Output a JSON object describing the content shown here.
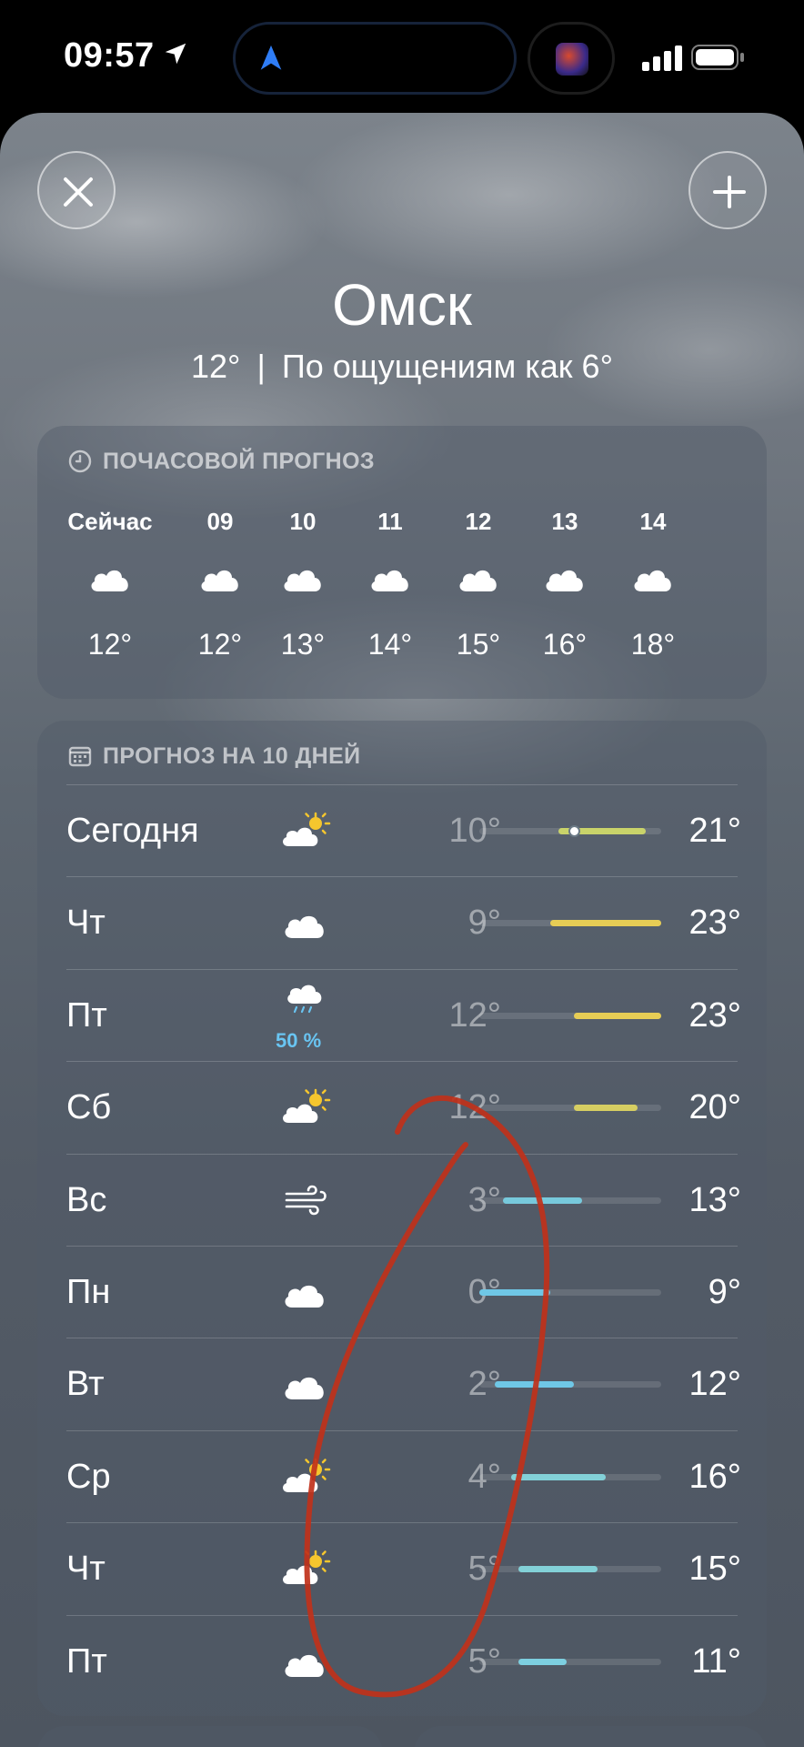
{
  "status_bar": {
    "time": "09:57"
  },
  "location": {
    "city": "Омск",
    "current_temp": "12°",
    "separator": "|",
    "feels_like": "По ощущениям как 6°"
  },
  "hourly": {
    "header": "ПОЧАСОВОЙ ПРОГНОЗ",
    "items": [
      {
        "time": "Сейчас",
        "icon": "cloud-icon",
        "temp": "12°"
      },
      {
        "time": "09",
        "icon": "cloud-icon",
        "temp": "12°"
      },
      {
        "time": "10",
        "icon": "cloud-icon",
        "temp": "13°"
      },
      {
        "time": "11",
        "icon": "cloud-icon",
        "temp": "14°"
      },
      {
        "time": "12",
        "icon": "cloud-icon",
        "temp": "15°"
      },
      {
        "time": "13",
        "icon": "cloud-icon",
        "temp": "16°"
      },
      {
        "time": "14",
        "icon": "cloud-icon",
        "temp": "18°"
      }
    ]
  },
  "daily": {
    "header": "ПРОГНОЗ НА 10 ДНЕЙ",
    "range": [
      0,
      23
    ],
    "days": [
      {
        "name": "Сегодня",
        "icon": "partly-sunny-icon",
        "pop": "",
        "lo": "10°",
        "hi": "21°",
        "lo_val": 10,
        "hi_val": 21,
        "current_val": 12,
        "color": "#c9d36a"
      },
      {
        "name": "Чт",
        "icon": "cloud-icon",
        "pop": "",
        "lo": "9°",
        "hi": "23°",
        "lo_val": 9,
        "hi_val": 23,
        "color": "#e7cd55"
      },
      {
        "name": "Пт",
        "icon": "rain-cloud-icon",
        "pop": "50 %",
        "lo": "12°",
        "hi": "23°",
        "lo_val": 12,
        "hi_val": 23,
        "color": "#e7cd55"
      },
      {
        "name": "Сб",
        "icon": "partly-sunny-icon",
        "pop": "",
        "lo": "12°",
        "hi": "20°",
        "lo_val": 12,
        "hi_val": 20,
        "color": "#d6ce62"
      },
      {
        "name": "Вс",
        "icon": "wind-icon",
        "pop": "",
        "lo": "3°",
        "hi": "13°",
        "lo_val": 3,
        "hi_val": 13,
        "color": "#77c9dc"
      },
      {
        "name": "Пн",
        "icon": "cloud-icon",
        "pop": "",
        "lo": "0°",
        "hi": "9°",
        "lo_val": 0,
        "hi_val": 9,
        "color": "#6fc7e6"
      },
      {
        "name": "Вт",
        "icon": "cloud-icon",
        "pop": "",
        "lo": "2°",
        "hi": "12°",
        "lo_val": 2,
        "hi_val": 12,
        "color": "#6fc7e6"
      },
      {
        "name": "Ср",
        "icon": "partly-sunny-icon",
        "pop": "",
        "lo": "4°",
        "hi": "16°",
        "lo_val": 4,
        "hi_val": 16,
        "color": "#83d1d8"
      },
      {
        "name": "Чт",
        "icon": "partly-sunny-icon",
        "pop": "",
        "lo": "5°",
        "hi": "15°",
        "lo_val": 5,
        "hi_val": 15,
        "color": "#83d1d8"
      },
      {
        "name": "Пт",
        "icon": "cloud-icon",
        "pop": "",
        "lo": "5°",
        "hi": "11°",
        "lo_val": 5,
        "hi_val": 11,
        "color": "#7dcfe0"
      }
    ]
  },
  "colors": {
    "annotation": "#c0311a",
    "pop": "#69c5f2"
  }
}
